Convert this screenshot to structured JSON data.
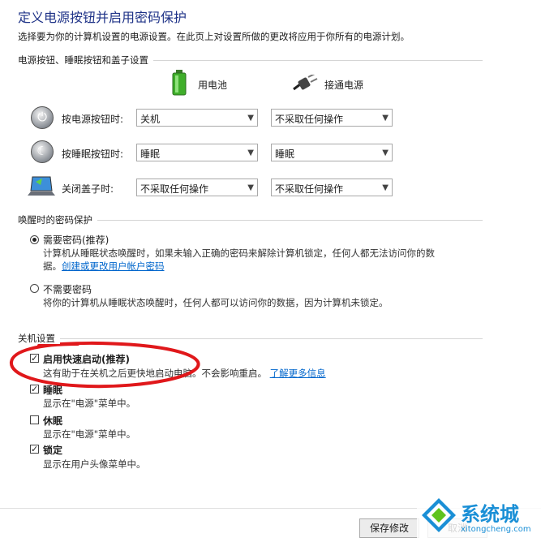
{
  "header": {
    "title": "定义电源按钮并启用密码保护",
    "description": "选择要为你的计算机设置的电源设置。在此页上对设置所做的更改将应用于你所有的电源计划。"
  },
  "power_section": {
    "title": "电源按钮、睡眠按钮和盖子设置",
    "col_battery": "用电池",
    "col_plugged": "接通电源",
    "rows": [
      {
        "label": "按电源按钮时:",
        "battery": "关机",
        "plugged": "不采取任何操作",
        "icon": "power-button-icon"
      },
      {
        "label": "按睡眠按钮时:",
        "battery": "睡眠",
        "plugged": "睡眠",
        "icon": "sleep-button-icon"
      },
      {
        "label": "关闭盖子时:",
        "battery": "不采取任何操作",
        "plugged": "不采取任何操作",
        "icon": "laptop-lid-icon"
      }
    ]
  },
  "password_section": {
    "title": "唤醒时的密码保护",
    "require_label": "需要密码(推荐)",
    "require_desc": "计算机从睡眠状态唤醒时，如果未输入正确的密码来解除计算机锁定，任何人都无法访问你的数",
    "require_desc2": "据。",
    "require_link": "创建或更改用户帐户密码",
    "norequire_label": "不需要密码",
    "norequire_desc": "将你的计算机从睡眠状态唤醒时，任何人都可以访问你的数据，因为计算机未锁定。",
    "selected": "require"
  },
  "shutdown_section": {
    "title": "关机设置",
    "items": [
      {
        "label": "启用快速启动(推荐)",
        "desc": "这有助于在关机之后更快地启动电脑。不会影响重启。",
        "link": "了解更多信息",
        "checked": true
      },
      {
        "label": "睡眠",
        "desc": "显示在\"电源\"菜单中。",
        "checked": true
      },
      {
        "label": "休眠",
        "desc": "显示在\"电源\"菜单中。",
        "checked": false
      },
      {
        "label": "锁定",
        "desc": "显示在用户头像菜单中。",
        "checked": true
      }
    ]
  },
  "footer": {
    "save_label": "保存修改",
    "cancel_label": "取消"
  },
  "watermark": {
    "brand_cn": "系统城",
    "brand_url": "xitongcheng.com"
  },
  "colors": {
    "title": "#1e3287",
    "link": "#0066cc",
    "annotation": "#e0181b",
    "watermark_blue": "#1a8fd6"
  }
}
